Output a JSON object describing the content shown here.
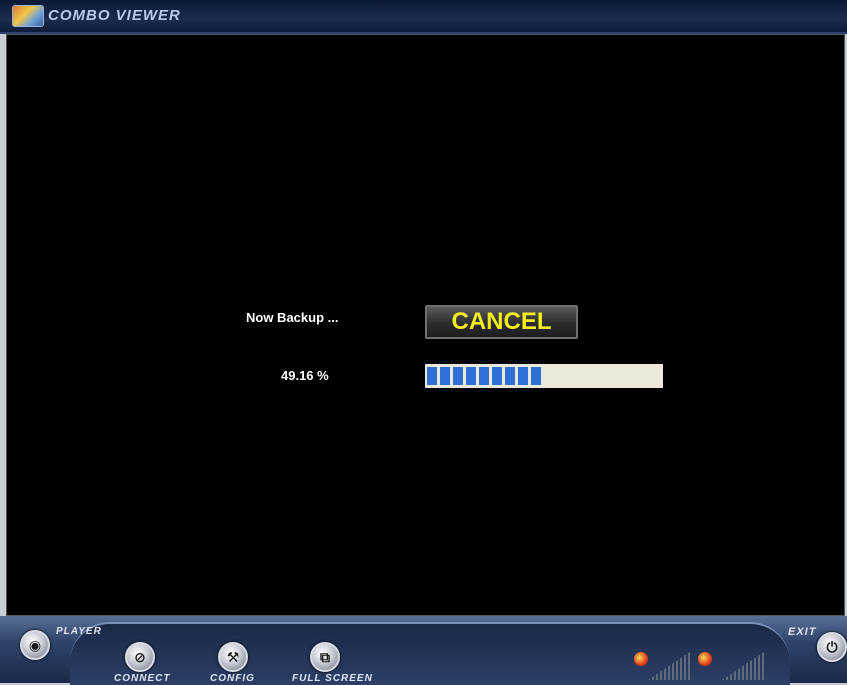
{
  "window": {
    "title": "COMBO VIEWER"
  },
  "dialog": {
    "status_text": "Now Backup ...",
    "percent_text": "49.16 %",
    "progress_percent": 49.16,
    "cancel_label": "CANCEL"
  },
  "controls": {
    "player_label": "PLAYER",
    "connect_label": "CONNECT",
    "config_label": "CONFIG",
    "fullscreen_label": "FULL SCREEN",
    "exit_label": "EXIT"
  },
  "icons": {
    "app": "app-logo-icon",
    "player": "player-icon",
    "connect": "connect-icon",
    "config": "config-icon",
    "fullscreen": "fullscreen-icon",
    "speaker": "speaker-icon",
    "mic": "mic-icon",
    "power": "power-icon"
  },
  "colors": {
    "accent_yellow": "#f2ee1c",
    "progress_blue": "#2f6fd8",
    "titlebar_navy": "#1a2c50"
  }
}
